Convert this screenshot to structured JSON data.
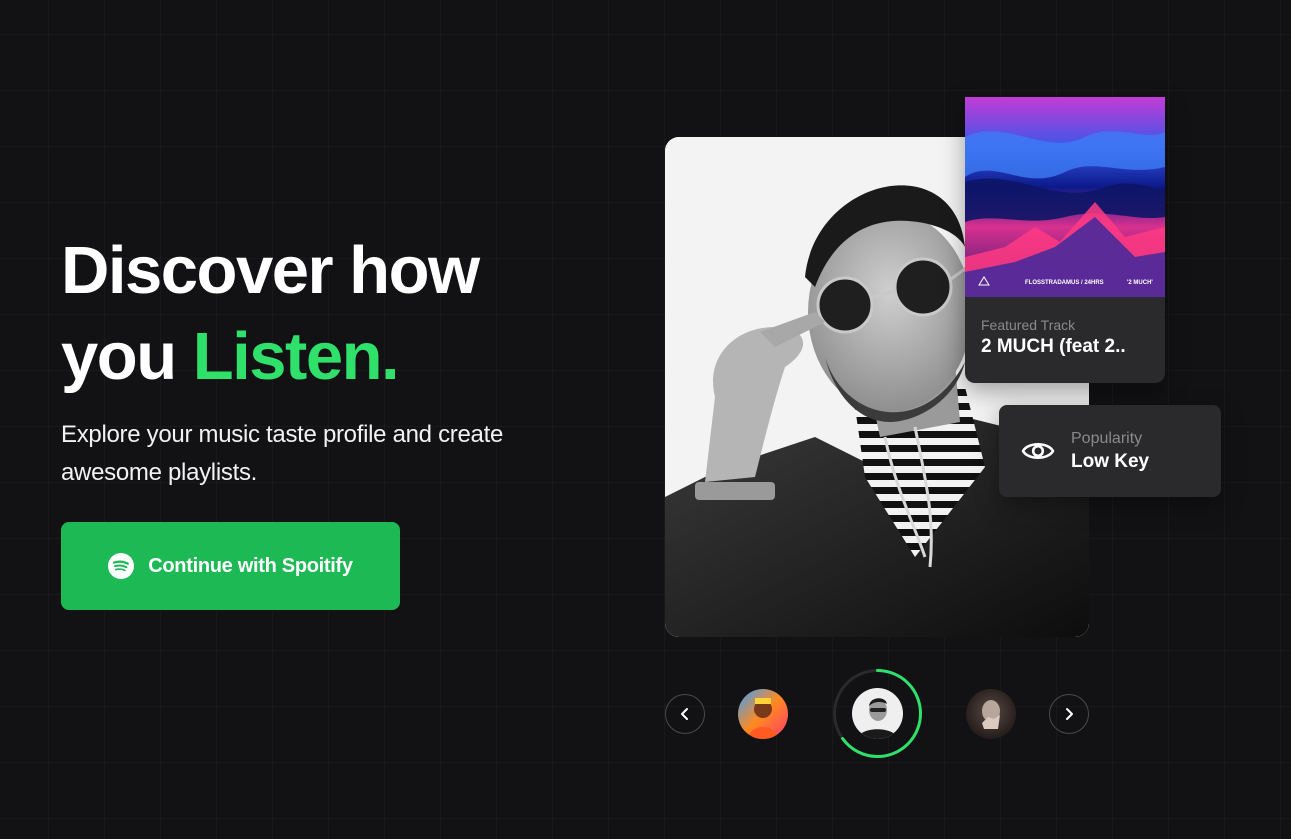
{
  "hero": {
    "title_line1": "Discover how",
    "title_line2_prefix": "you ",
    "title_line2_accent": "Listen.",
    "subtitle": "Explore your music taste profile and create awesome playlists.",
    "cta_label": "Continue with Spoitify",
    "cta_icon": "spotify-icon"
  },
  "colors": {
    "background": "#121215",
    "accent": "#2fe06a",
    "cta": "#1db954",
    "card": "#2a2a2d"
  },
  "featured": {
    "label": "Featured Track",
    "track_name": "2 MUCH (feat 2..",
    "album_caption": "FLOSSTRADAMUS / 24HRS",
    "album_caption_right": "'2 MUCH'"
  },
  "popularity": {
    "label": "Popularity",
    "value": "Low Key",
    "icon": "eye-icon"
  },
  "carousel": {
    "prev_icon": "chevron-left-icon",
    "next_icon": "chevron-right-icon",
    "active_index": 1,
    "progress": 0.65,
    "artists": [
      "artist-1",
      "artist-2",
      "artist-3"
    ]
  }
}
